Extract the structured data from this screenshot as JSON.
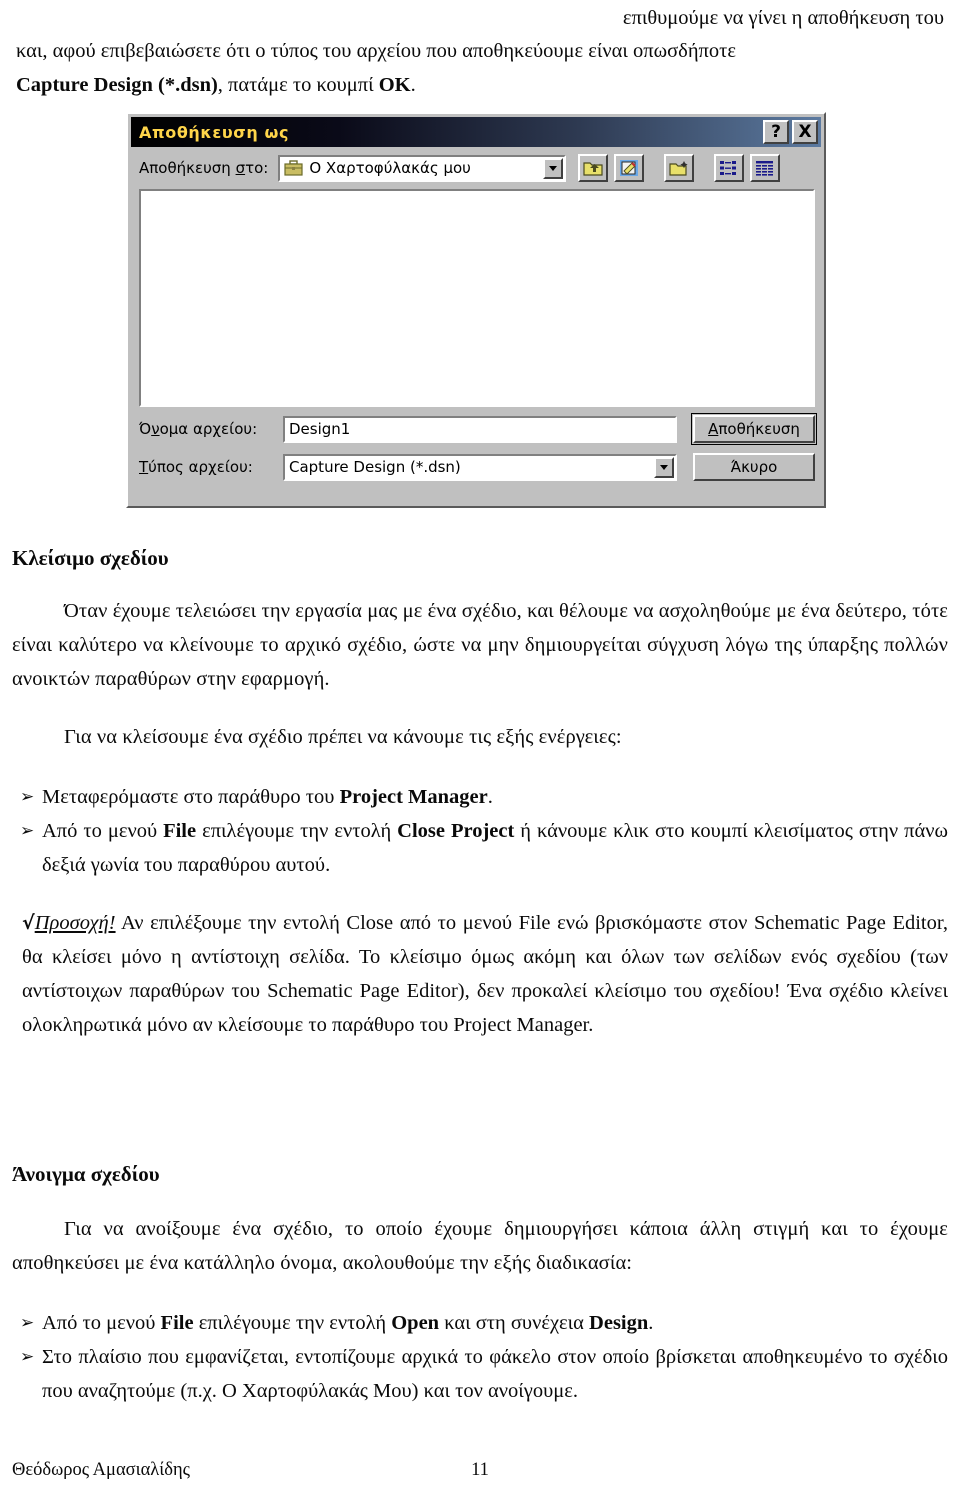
{
  "intro": {
    "line1": "επιθυμούμε να γίνει η αποθήκευση του",
    "line2": "και, αφού επιβεβαιώσετε ότι ο τύπος του αρχείου που αποθηκεύουμε είναι οπωσδήποτε",
    "line3_bold1": "Capture Design (*.dsn)",
    "line3_mid": ", πατάμε το κουμπί ",
    "line3_bold2": "OK",
    "line3_end": "."
  },
  "dialog": {
    "title": "Αποθήκευση ως",
    "help_button": "?",
    "close_button": "X",
    "look_in_label_pre": "Αποθήκευση ",
    "look_in_label_underlined": "σ",
    "look_in_label_post": "το:",
    "look_in_value": "Ο Χαρτοφύλακάς μου",
    "toolbar_icons": [
      "up-one-level-icon",
      "create-shortcut-icon",
      "new-folder-icon",
      "list-view-icon",
      "details-view-icon"
    ],
    "file_name_label_pre": "Ό",
    "file_name_label_underlined": "ν",
    "file_name_label_post": "ομα αρχείου:",
    "file_name_value": "Design1",
    "file_type_label_underlined": "Τ",
    "file_type_label_post": "ύπος αρχείου:",
    "file_type_value": "Capture Design (*.dsn)",
    "save_button_underlined": "Α",
    "save_button_post": "ποθήκευση",
    "cancel_button": "Άκυρο",
    "colors": {
      "face": "#c0c0c0",
      "title_text": "#ffd54a",
      "title_bar_left": "#000000",
      "title_bar_right": "#5c7aa0",
      "folder_icon": "#e8e06a"
    }
  },
  "section_close": {
    "heading": "Κλείσιμο σχεδίου",
    "para1": "Όταν έχουμε τελειώσει την εργασία μας με ένα σχέδιο, και θέλουμε να ασχοληθούμε με ένα δεύτερο, τότε είναι καλύτερο να κλείνουμε το αρχικό σχέδιο, ώστε να μην δημιουργείται σύγχυση λόγω της ύπαρξης πολλών ανοικτών παραθύρων στην εφαρμογή.",
    "para2": "Για να κλείσουμε ένα σχέδιο πρέπει να κάνουμε τις εξής ενέργειες:",
    "bullet_mark": "➢",
    "bullets": [
      {
        "pre": "Μεταφερόμαστε στο παράθυρο του ",
        "bold": "Project Manager",
        "post": "."
      },
      {
        "pre": "Από το μενού ",
        "bold": "File",
        "mid": " επιλέγουμε την εντολή ",
        "bold2": "Close Project",
        "post": " ή κάνουμε κλικ στο κουμπί κλεισίματος στην πάνω δεξιά γωνία του παραθύρου αυτού."
      }
    ],
    "note_check": "√",
    "note_warn": "Προσοχή!",
    "note_body": " Αν επιλέξουμε την εντολή Close από το μενού File ενώ βρισκόμαστε στον Schematic Page Editor, θα κλείσει μόνο η αντίστοιχη σελίδα. Το κλείσιμο όμως ακόμη και όλων των σελίδων ενός σχεδίου (των αντίστοιχων παραθύρων του Schematic Page Editor), δεν προκαλεί κλείσιμο του σχεδίου! Ένα σχέδιο κλείνει ολοκληρωτικά μόνο αν κλείσουμε το παράθυρο του Project Manager."
  },
  "section_open": {
    "heading": "Άνοιγμα σχεδίου",
    "para1": "Για να ανοίξουμε ένα σχέδιο, το οποίο έχουμε δημιουργήσει κάποια άλλη στιγμή και το έχουμε αποθηκεύσει με ένα κατάλληλο όνομα, ακολουθούμε την εξής διαδικασία:",
    "bullet_mark": "➢",
    "bullets": [
      {
        "pre": "Από το μενού ",
        "bold": "File",
        "mid": " επιλέγουμε την εντολή ",
        "bold2": "Open",
        "mid2": " και στη συνέχεια ",
        "bold3": "Design",
        "post": "."
      },
      {
        "pre": "Στο πλαίσιο που εμφανίζεται, εντοπίζουμε αρχικά το φάκελο στον οποίο βρίσκεται αποθηκευμένο το σχέδιο που αναζητούμε (π.χ. Ο Χαρτοφύλακάς Μου) και τον ανοίγουμε."
      }
    ]
  },
  "footer": {
    "author": "Θεόδωρος Αμασιαλίδης",
    "page_number": "11"
  }
}
